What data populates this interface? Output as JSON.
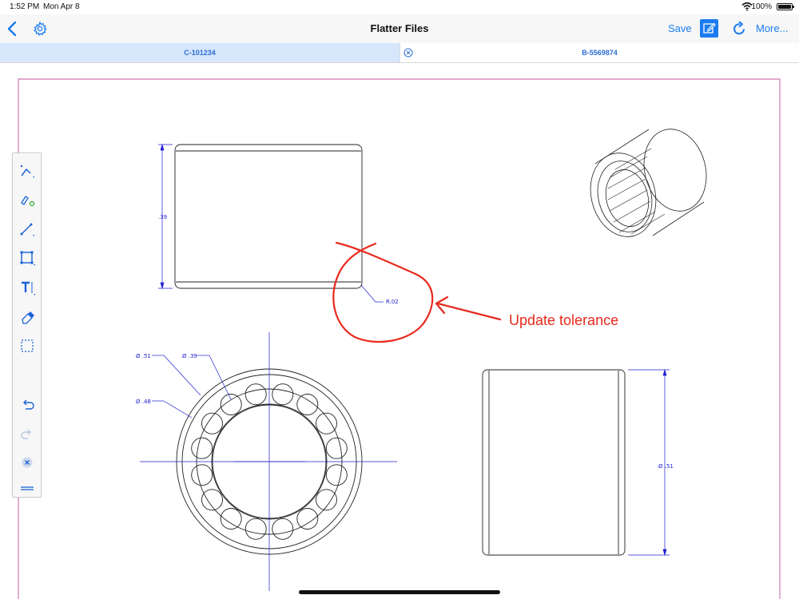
{
  "status_bar": {
    "time": "1:52 PM",
    "date": "Mon Apr 8",
    "battery": "100%"
  },
  "nav": {
    "title": "Flatter Files",
    "save_label": "Save",
    "more_label": "More..."
  },
  "tabs": [
    {
      "label": "C-101234",
      "active": true
    },
    {
      "label": "B-5569874",
      "active": false
    }
  ],
  "drawing": {
    "dim_height": ".39",
    "dim_radius": "R.02",
    "dim_dia_outer": "Ø .51",
    "dim_dia_inner": "Ø .39",
    "dim_dia_mid": "Ø .48",
    "dim_side": "Ø .51"
  },
  "annotation": {
    "text": "Update tolerance",
    "color": "#e8291c"
  },
  "palette": {
    "tools": [
      "pen-tool",
      "highlighter-tool",
      "line-tool",
      "rectangle-tool",
      "text-tool",
      "eraser-tool",
      "selection-tool",
      "undo",
      "redo",
      "clear",
      "collapse"
    ]
  },
  "colors": {
    "accent": "#1a7cf0",
    "dimension": "#2020d0",
    "annotation": "#e8291c",
    "border": "#c0509a"
  }
}
